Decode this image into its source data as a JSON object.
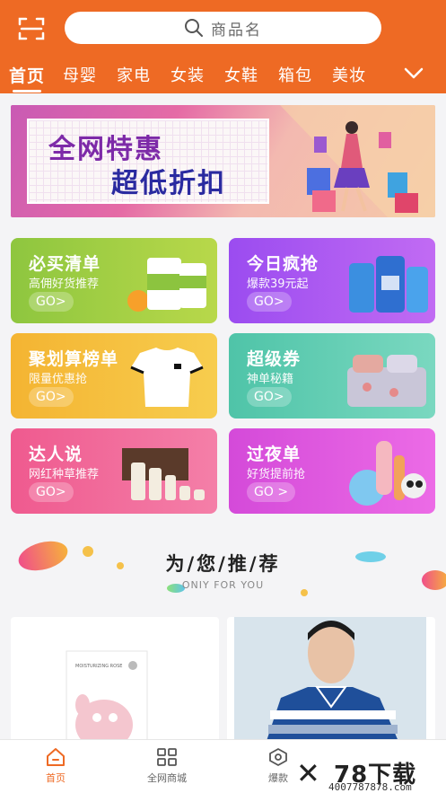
{
  "header": {
    "search_placeholder": "商品名",
    "tabs": [
      {
        "label": "首页",
        "active": true
      },
      {
        "label": "母婴"
      },
      {
        "label": "家电"
      },
      {
        "label": "女装"
      },
      {
        "label": "女鞋"
      },
      {
        "label": "箱包"
      },
      {
        "label": "美妆"
      }
    ],
    "accent": "#ee6a24"
  },
  "banner": {
    "line1": "全网特惠",
    "line2": "超低折扣"
  },
  "cards": [
    {
      "title": "必买清单",
      "subtitle": "高佣好货推荐",
      "go": "GO>"
    },
    {
      "title": "今日疯抢",
      "subtitle": "爆款39元起",
      "go": "GO>"
    },
    {
      "title": "聚划算榜单",
      "subtitle": "限量优惠抢",
      "go": "GO>"
    },
    {
      "title": "超级券",
      "subtitle": "神单秘籍",
      "go": "GO>"
    },
    {
      "title": "达人说",
      "subtitle": "网红种草推荐",
      "go": "GO>"
    },
    {
      "title": "过夜单",
      "subtitle": "好货提前抢",
      "go": "GO >"
    }
  ],
  "recommend": {
    "title": "为/您/推/荐",
    "subtitle": "ONIY FOR YOU"
  },
  "products": [
    {
      "image_text": "MOISTURIZING ROSE"
    },
    {
      "image_text": ""
    }
  ],
  "bottom_nav": [
    {
      "label": "首页",
      "icon": "home-icon",
      "active": true
    },
    {
      "label": "全网商城",
      "icon": "grid-icon"
    },
    {
      "label": "爆款",
      "icon": "hexagon-icon"
    }
  ],
  "watermark": {
    "brand": "78下载",
    "url": "4007787878.com"
  }
}
